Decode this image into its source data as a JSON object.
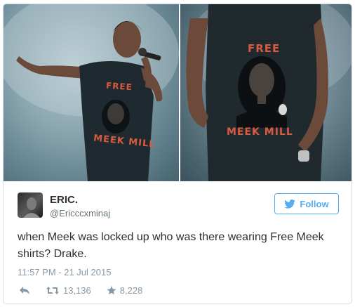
{
  "media": {
    "left_photo": {
      "shirt_line1": "FREE",
      "shirt_line2": "MEEK MILL"
    },
    "right_photo": {
      "shirt_line1": "FREE",
      "shirt_line2": "MEEK MILL"
    }
  },
  "author": {
    "name": "ERIC.",
    "handle": "@Ericccxminaj",
    "avatar_icon": "profile-photo"
  },
  "follow": {
    "label": "Follow",
    "icon": "twitter-bird-icon",
    "color": "#55acee"
  },
  "tweet": {
    "text": "when Meek was locked up who was there wearing Free Meek shirts? Drake.",
    "timestamp": "11:57 PM - 21 Jul 2015"
  },
  "actions": {
    "reply_icon": "reply-icon",
    "retweet_icon": "retweet-icon",
    "retweet_count": "13,136",
    "like_icon": "star-icon",
    "like_count": "8,228"
  },
  "colors": {
    "text": "#292f33",
    "secondary": "#66757f",
    "meta": "#8899a6",
    "border": "#d8dee3"
  }
}
